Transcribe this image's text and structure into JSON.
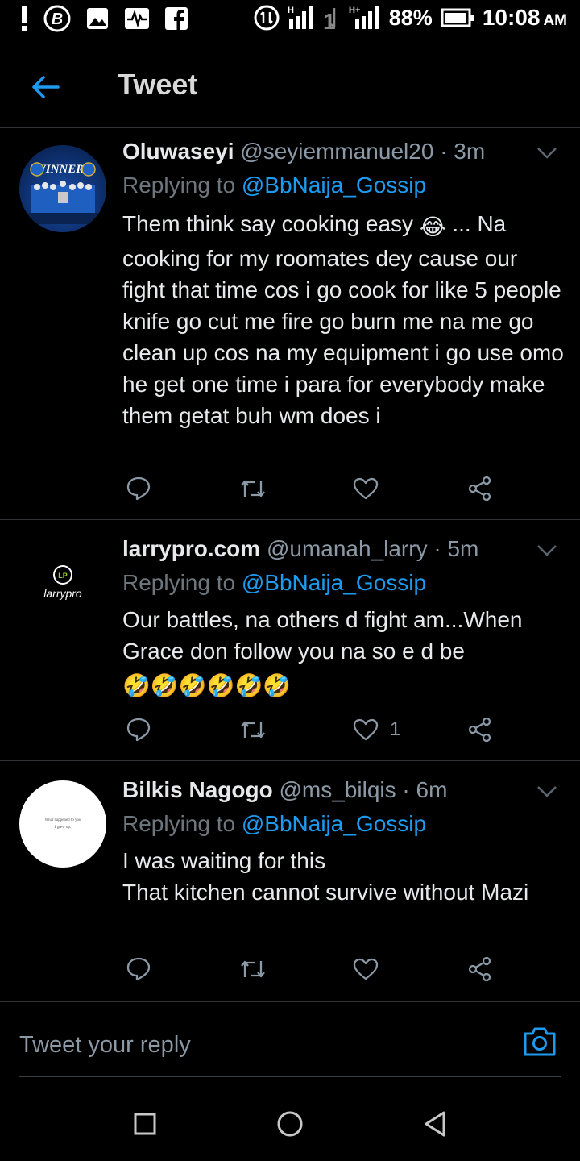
{
  "status_bar": {
    "battery_percent": "88%",
    "time": "10:08",
    "ampm": "AM",
    "icons": [
      "alert-icon",
      "b-app-icon",
      "image-icon",
      "pulse-app-icon",
      "facebook-icon",
      "mobile-data-icon",
      "signal-h-icon",
      "data-arrows-icon",
      "signal-hplus-icon",
      "battery-icon"
    ]
  },
  "header": {
    "title": "Tweet",
    "back_icon": "back-arrow-icon"
  },
  "tweets": [
    {
      "name": "Oluwaseyi",
      "handle": "@seyiemmanuel20",
      "time": "3m",
      "reply_prefix": "Replying to",
      "mention": "@BbNaija_Gossip",
      "body_before": "Them think say cooking easy ",
      "body_emoji": "😂",
      "body_after": " ... Na cooking for my roomates dey cause our fight that time cos i go cook for like 5 people knife go cut me fire go burn me na me go clean up cos na my equipment i go use omo he get one time i para for everybody make them getat buh wm does i",
      "avatar_text": "WINNERS",
      "like_count": ""
    },
    {
      "name": "larrypro.com",
      "handle": "@umanah_larry",
      "time": "5m",
      "reply_prefix": "Replying to",
      "mention": "@BbNaija_Gossip",
      "body_before": "Our battles, na others d fight am...When Grace don follow you na so e d be",
      "body_emoji": "🤣🤣🤣🤣🤣🤣",
      "body_after": "",
      "avatar_text": "larrypro",
      "avatar_initials": "LP",
      "like_count": "1"
    },
    {
      "name": "Bilkis Nagogo",
      "handle": "@ms_bilqis",
      "time": "6m",
      "reply_prefix": "Replying to",
      "mention": "@BbNaija_Gossip",
      "body_before": "I was waiting for this\nThat kitchen cannot survive without Mazi",
      "body_emoji": "",
      "body_after": "",
      "avatar_text": "What happened to you\nI grew up.",
      "like_count": ""
    }
  ],
  "reply_bar": {
    "placeholder": "Tweet your reply",
    "camera_icon": "camera-icon"
  },
  "nav_bar": {
    "icons": [
      "recents-square-icon",
      "home-circle-icon",
      "back-triangle-icon"
    ]
  },
  "colors": {
    "background": "#000000",
    "accent": "#1d9bf0",
    "muted": "#8b98a5",
    "divider": "#2f3336"
  }
}
